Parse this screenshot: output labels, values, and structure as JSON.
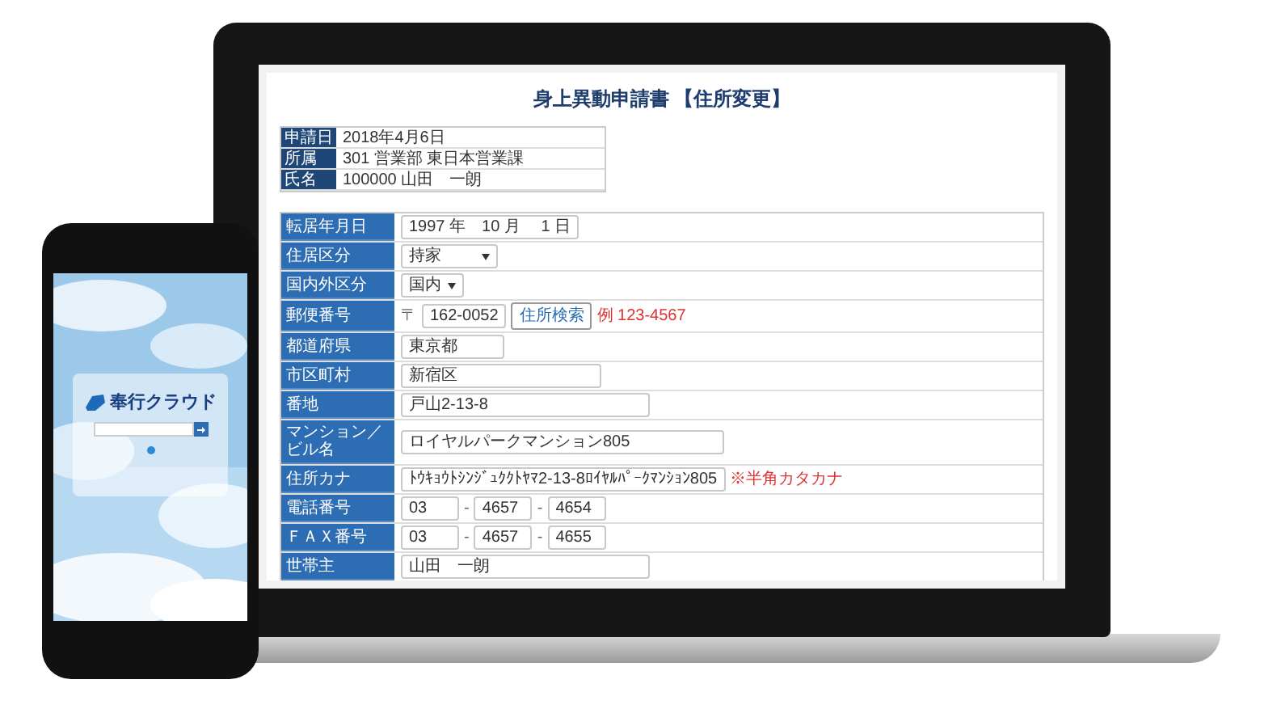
{
  "document": {
    "title": "身上異動申請書 【住所変更】",
    "info": [
      {
        "label": "申請日",
        "value": "2018年4月6日"
      },
      {
        "label": "所属",
        "value": "301 営業部 東日本営業課"
      },
      {
        "label": "氏名",
        "value": "100000 山田　一朗"
      }
    ],
    "form": [
      {
        "label": "転居年月日",
        "kind": "text",
        "values": [
          "1997 年　10 月　 1 日"
        ]
      },
      {
        "label": "住居区分",
        "kind": "select",
        "values": [
          "持家"
        ]
      },
      {
        "label": "国内外区分",
        "kind": "select",
        "values": [
          "国内"
        ]
      },
      {
        "label": "郵便番号",
        "kind": "postal",
        "prefix": "〒",
        "values": [
          "162-0052"
        ],
        "button": "住所検索",
        "note": "例 123-4567"
      },
      {
        "label": "都道府県",
        "kind": "text",
        "values": [
          "東京都"
        ]
      },
      {
        "label": "市区町村",
        "kind": "text",
        "values": [
          "新宿区"
        ]
      },
      {
        "label": "番地",
        "kind": "text",
        "values": [
          "戸山2-13-8"
        ]
      },
      {
        "label": "マンション／ビル名",
        "kind": "text",
        "values": [
          "ロイヤルパークマンション805"
        ]
      },
      {
        "label": "住所カナ",
        "kind": "text",
        "values": [
          "ﾄｳｷｮｳﾄｼﾝｼﾞｭｸｸﾄﾔﾏ2-13-8ﾛｲﾔﾙﾊﾟｰｸﾏﾝｼｮﾝ805"
        ],
        "note": "※半角カタカナ"
      },
      {
        "label": "電話番号",
        "kind": "split",
        "separator": "-",
        "values": [
          "03",
          "4657",
          "4654"
        ]
      },
      {
        "label": "ＦＡＸ番号",
        "kind": "split",
        "separator": "-",
        "values": [
          "03",
          "4657",
          "4655"
        ]
      },
      {
        "label": "世帯主",
        "kind": "text",
        "values": [
          "山田　一朗"
        ]
      }
    ]
  },
  "phone": {
    "logo": "奉行クラウド"
  }
}
